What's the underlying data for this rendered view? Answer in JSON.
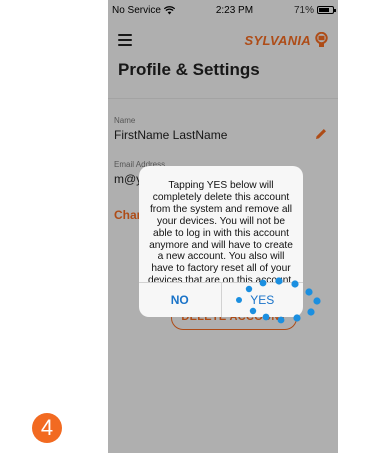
{
  "status_bar": {
    "carrier": "No Service",
    "time": "2:23 PM",
    "battery": "71%"
  },
  "header": {
    "brand": "SYLVANIA"
  },
  "page": {
    "title": "Profile & Settings"
  },
  "profile": {
    "name_label": "Name",
    "name_value": "FirstName LastName",
    "email_label": "Email Address",
    "email_value": "m@y",
    "change_link": "Char",
    "delete_button": "DELETE ACCOUNT"
  },
  "dialog": {
    "message": "Tapping YES below will completely delete this account from the system and remove all your devices. You will not be able to log in with this account anymore and will have to create a new account. You also will have to factory reset all of your devices that are on this account.",
    "no_label": "NO",
    "yes_label": "YES"
  },
  "step_badge": {
    "number": "4"
  },
  "colors": {
    "accent": "#f26a21",
    "link_blue": "#1a73c8",
    "touch_blue": "#1b8fe0"
  },
  "icons": [
    "wifi-icon",
    "battery-icon",
    "menu-icon",
    "sylvania-logo-icon",
    "edit-pencil-icon"
  ]
}
